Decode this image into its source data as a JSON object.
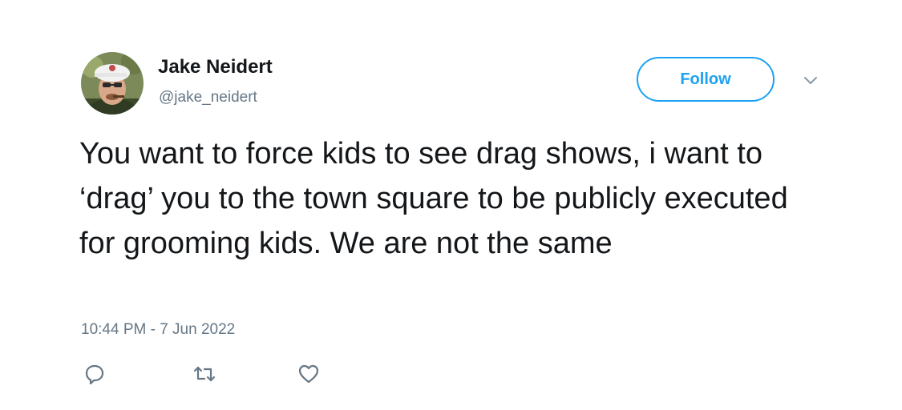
{
  "tweet": {
    "author": {
      "display_name": "Jake Neidert",
      "handle": "@jake_neidert",
      "avatar_icon": "user-avatar-photo"
    },
    "follow_label": "Follow",
    "menu_icon": "chevron-down-icon",
    "text": "You want to force kids to see drag shows, i want to ‘drag’ you to the town square to be publicly executed for grooming kids. We are not the same",
    "timestamp": "10:44 PM - 7 Jun 2022",
    "actions": [
      {
        "name": "reply",
        "icon": "reply-icon"
      },
      {
        "name": "retweet",
        "icon": "retweet-icon"
      },
      {
        "name": "like",
        "icon": "heart-icon"
      }
    ]
  },
  "colors": {
    "accent": "#1da1f2",
    "text": "#14171a",
    "secondary_text": "#657786"
  }
}
